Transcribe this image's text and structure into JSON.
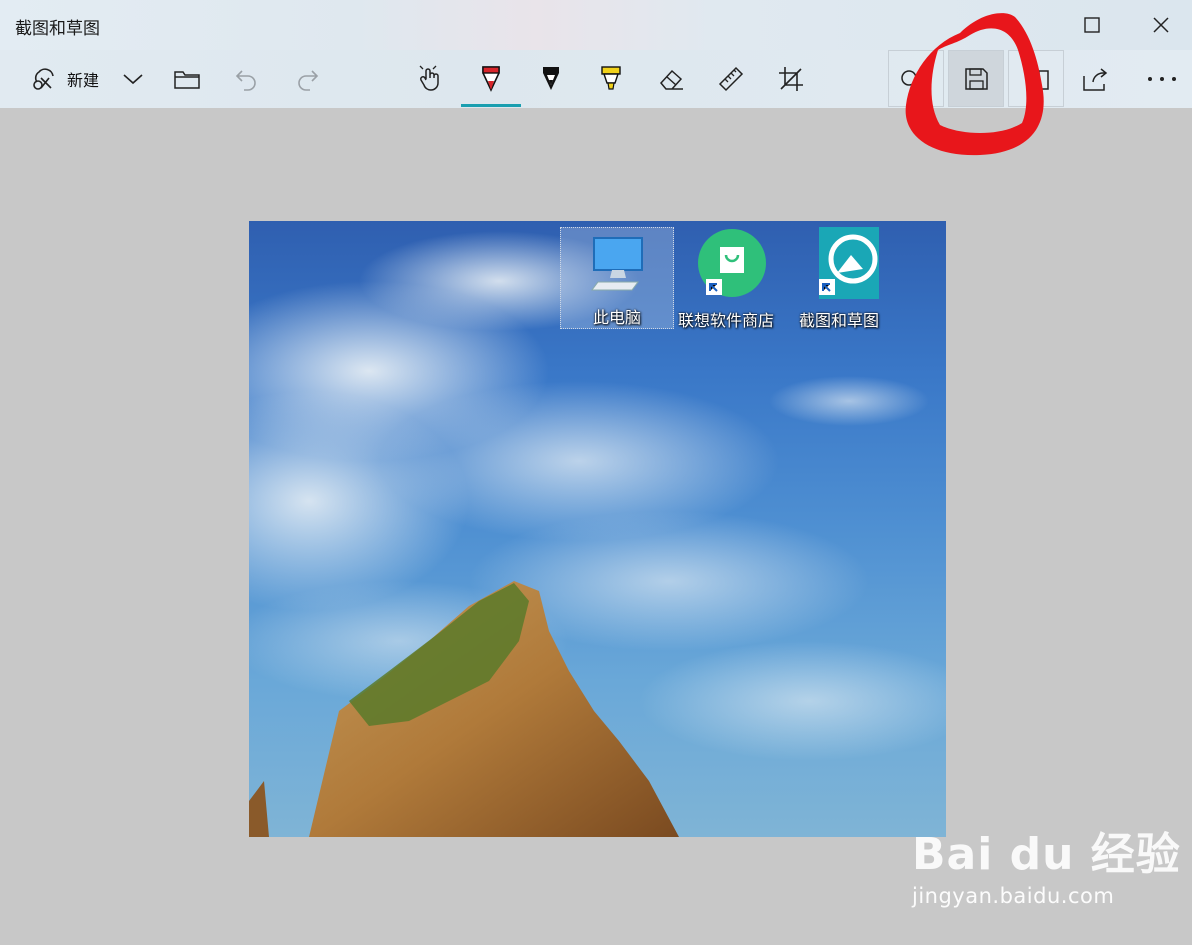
{
  "window": {
    "title": "截图和草图"
  },
  "toolbar": {
    "new_label": "新建"
  },
  "desktop_icons": [
    {
      "label": "此电脑"
    },
    {
      "label": "联想软件商店"
    },
    {
      "label": "截图和草图"
    }
  ],
  "watermark": {
    "logo": "Bai du 经验",
    "url": "jingyan.baidu.com"
  },
  "colors": {
    "accent_underline": "#1a9fb0",
    "annotation_red": "#e8161b",
    "pen_red": "#d8262b",
    "highlighter_yellow": "#f2d21a"
  }
}
